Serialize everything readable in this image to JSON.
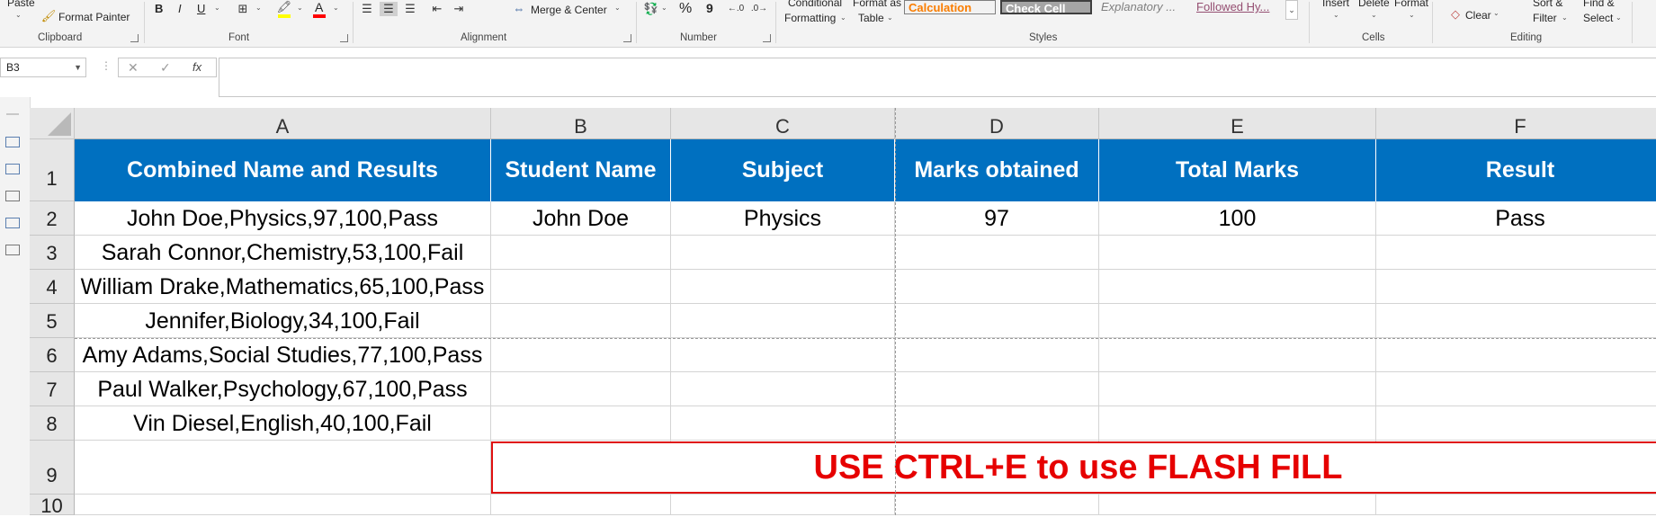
{
  "ribbon": {
    "clipboard": {
      "paste": "Paste",
      "format_painter": "Format Painter",
      "group": "Clipboard"
    },
    "font": {
      "bold": "B",
      "italic": "I",
      "underline": "U",
      "font_color_glyph": "A",
      "group": "Font"
    },
    "alignment": {
      "merge_center": "Merge & Center",
      "group": "Alignment"
    },
    "number": {
      "percent": "%",
      "comma": "9",
      "group": "Number"
    },
    "styles": {
      "conditional_1": "Conditional",
      "conditional_2": "Formatting",
      "format_table_1": "Format as",
      "format_table_2": "Table",
      "calculation": "Calculation",
      "check_cell": "Check Cell",
      "explanatory": "Explanatory ...",
      "followed": "Followed Hy...",
      "group": "Styles"
    },
    "cells": {
      "insert": "Insert",
      "delete": "Delete",
      "format": "Format",
      "group": "Cells"
    },
    "editing": {
      "clear": "Clear",
      "sort_1": "Sort &",
      "sort_2": "Filter",
      "find_1": "Find &",
      "find_2": "Select",
      "group": "Editing"
    }
  },
  "formula_bar": {
    "name_box": "B3",
    "fx": "fx",
    "cancel": "✕",
    "enter": "✓",
    "formula": ""
  },
  "columns": [
    "A",
    "B",
    "C",
    "D",
    "E",
    "F"
  ],
  "rows": [
    "1",
    "2",
    "3",
    "4",
    "5",
    "6",
    "7",
    "8",
    "9",
    "10"
  ],
  "header_row": [
    "Combined Name and Results",
    "Student Name",
    "Subject",
    "Marks obtained",
    "Total Marks",
    "Result"
  ],
  "data_rows": [
    [
      "John Doe,Physics,97,100,Pass",
      "John Doe",
      "Physics",
      "97",
      "100",
      "Pass"
    ],
    [
      "Sarah Connor,Chemistry,53,100,Fail",
      "",
      "",
      "",
      "",
      ""
    ],
    [
      "William Drake,Mathematics,65,100,Pass",
      "",
      "",
      "",
      "",
      ""
    ],
    [
      "Jennifer,Biology,34,100,Fail",
      "",
      "",
      "",
      "",
      ""
    ],
    [
      "Amy Adams,Social Studies,77,100,Pass",
      "",
      "",
      "",
      "",
      ""
    ],
    [
      "Paul Walker,Psychology,67,100,Pass",
      "",
      "",
      "",
      "",
      ""
    ],
    [
      "Vin Diesel,English,40,100,Fail",
      "",
      "",
      "",
      "",
      ""
    ]
  ],
  "note": "USE CTRL+E to use FLASH FILL",
  "colors": {
    "header_fill": "#0070c0",
    "note_red": "#e60000"
  }
}
